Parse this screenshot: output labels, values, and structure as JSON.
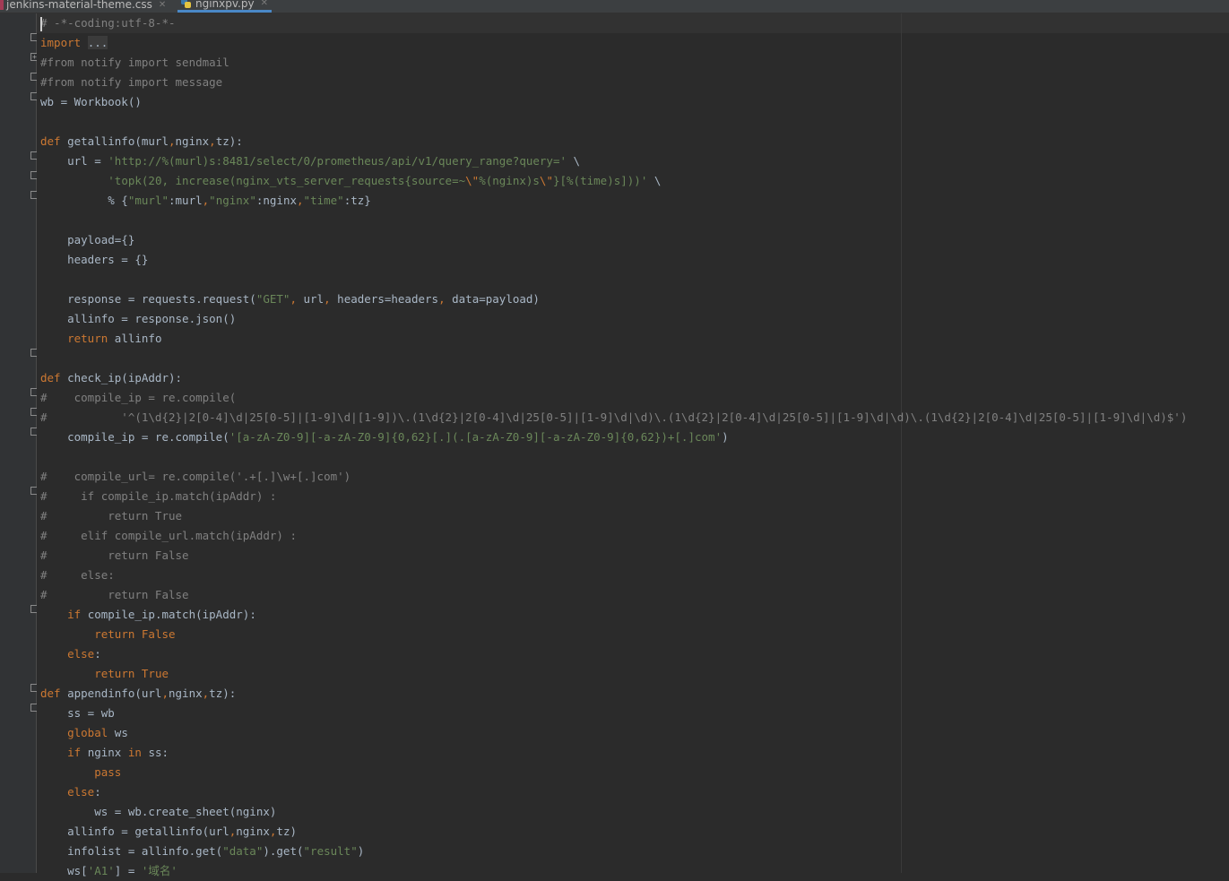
{
  "tabs": [
    {
      "label": "jenkins-material-theme.css",
      "active": false,
      "icon": "css-file-icon"
    },
    {
      "label": "nginxpv.py",
      "active": true,
      "icon": "python-file-icon"
    }
  ],
  "colors": {
    "background": "#2b2b2b",
    "gutter": "#313335",
    "keyword": "#cc7832",
    "string": "#6a8759",
    "comment": "#808080",
    "text": "#a9b7c6"
  },
  "code": [
    [
      [
        "cm",
        "# -*-coding:utf-8-*-"
      ]
    ],
    [
      [
        "kw",
        "import"
      ],
      [
        "t",
        " "
      ],
      [
        "h",
        "..."
      ]
    ],
    [
      [
        "cm",
        "#from notify import sendmail"
      ]
    ],
    [
      [
        "cm",
        "#from notify import message"
      ]
    ],
    [
      [
        "t",
        "wb = Workbook()"
      ]
    ],
    [],
    [
      [
        "kw",
        "def"
      ],
      [
        "t",
        " getallinfo(murl"
      ],
      [
        "kw",
        ","
      ],
      [
        "t",
        "nginx"
      ],
      [
        "kw",
        ","
      ],
      [
        "t",
        "tz):"
      ]
    ],
    [
      [
        "t",
        "    url = "
      ],
      [
        "s",
        "'http://%(murl)s:8481/select/0/prometheus/api/v1/query_range?query='"
      ],
      [
        "t",
        " \\"
      ]
    ],
    [
      [
        "t",
        "          "
      ],
      [
        "s",
        "'topk(20, increase(nginx_vts_server_requests{source=~"
      ],
      [
        "kw",
        "\\\""
      ],
      [
        "s",
        "%(nginx)s"
      ],
      [
        "kw",
        "\\\""
      ],
      [
        "s",
        "}[%(time)s]))'"
      ],
      [
        "t",
        " \\"
      ]
    ],
    [
      [
        "t",
        "          % {"
      ],
      [
        "s",
        "\"murl\""
      ],
      [
        "t",
        ":murl"
      ],
      [
        "kw",
        ","
      ],
      [
        "s",
        "\"nginx\""
      ],
      [
        "t",
        ":nginx"
      ],
      [
        "kw",
        ","
      ],
      [
        "s",
        "\"time\""
      ],
      [
        "t",
        ":tz}"
      ]
    ],
    [],
    [
      [
        "t",
        "    payload={}"
      ]
    ],
    [
      [
        "t",
        "    headers = {}"
      ]
    ],
    [],
    [
      [
        "t",
        "    response = requests.request("
      ],
      [
        "s",
        "\"GET\""
      ],
      [
        "kw",
        ","
      ],
      [
        "t",
        " url"
      ],
      [
        "kw",
        ","
      ],
      [
        "t",
        " headers=headers"
      ],
      [
        "kw",
        ","
      ],
      [
        "t",
        " data=payload)"
      ]
    ],
    [
      [
        "t",
        "    allinfo = response.json()"
      ]
    ],
    [
      [
        "t",
        "    "
      ],
      [
        "kw",
        "return"
      ],
      [
        "t",
        " allinfo"
      ]
    ],
    [],
    [
      [
        "kw",
        "def"
      ],
      [
        "t",
        " check_ip(ipAddr):"
      ]
    ],
    [
      [
        "cm",
        "#    compile_ip = re.compile("
      ]
    ],
    [
      [
        "cm",
        "#           '^(1\\d{2}|2[0-4]\\d|25[0-5]|[1-9]\\d|[1-9])\\.(1\\d{2}|2[0-4]\\d|25[0-5]|[1-9]\\d|\\d)\\.(1\\d{2}|2[0-4]\\d|25[0-5]|[1-9]\\d|\\d)\\.(1\\d{2}|2[0-4]\\d|25[0-5]|[1-9]\\d|\\d)$')"
      ]
    ],
    [
      [
        "t",
        "    compile_ip = re.compile("
      ],
      [
        "s",
        "'[a-zA-Z0-9][-a-zA-Z0-9]{0,62}[.](.[a-zA-Z0-9][-a-zA-Z0-9]{0,62})+[.]com'"
      ],
      [
        "t",
        ")"
      ]
    ],
    [],
    [
      [
        "cm",
        "#    compile_url= re.compile('.+[.]\\w+[.]com')"
      ]
    ],
    [
      [
        "cm",
        "#     if compile_ip.match(ipAddr) :"
      ]
    ],
    [
      [
        "cm",
        "#         return True"
      ]
    ],
    [
      [
        "cm",
        "#     elif compile_url.match(ipAddr) :"
      ]
    ],
    [
      [
        "cm",
        "#         return False"
      ]
    ],
    [
      [
        "cm",
        "#     else:"
      ]
    ],
    [
      [
        "cm",
        "#         return False"
      ]
    ],
    [
      [
        "t",
        "    "
      ],
      [
        "kw",
        "if"
      ],
      [
        "t",
        " compile_ip.match(ipAddr):"
      ]
    ],
    [
      [
        "t",
        "        "
      ],
      [
        "kw",
        "return False"
      ]
    ],
    [
      [
        "t",
        "    "
      ],
      [
        "kw",
        "else"
      ],
      [
        "t",
        ":"
      ]
    ],
    [
      [
        "t",
        "        "
      ],
      [
        "kw",
        "return True"
      ]
    ],
    [
      [
        "kw",
        "def"
      ],
      [
        "t",
        " appendinfo(url"
      ],
      [
        "kw",
        ","
      ],
      [
        "t",
        "nginx"
      ],
      [
        "kw",
        ","
      ],
      [
        "t",
        "tz):"
      ]
    ],
    [
      [
        "t",
        "    ss = wb"
      ]
    ],
    [
      [
        "t",
        "    "
      ],
      [
        "kw",
        "global"
      ],
      [
        "t",
        " ws"
      ]
    ],
    [
      [
        "t",
        "    "
      ],
      [
        "kw",
        "if"
      ],
      [
        "t",
        " nginx "
      ],
      [
        "kw",
        "in"
      ],
      [
        "t",
        " ss:"
      ]
    ],
    [
      [
        "t",
        "        "
      ],
      [
        "kw",
        "pass"
      ]
    ],
    [
      [
        "t",
        "    "
      ],
      [
        "kw",
        "else"
      ],
      [
        "t",
        ":"
      ]
    ],
    [
      [
        "t",
        "        ws = wb.create_sheet(nginx)"
      ]
    ],
    [
      [
        "t",
        "    allinfo = getallinfo(url"
      ],
      [
        "kw",
        ","
      ],
      [
        "t",
        "nginx"
      ],
      [
        "kw",
        ","
      ],
      [
        "t",
        "tz)"
      ]
    ],
    [
      [
        "t",
        "    infolist = allinfo.get("
      ],
      [
        "s",
        "\"data\""
      ],
      [
        "t",
        ").get("
      ],
      [
        "s",
        "\"result\""
      ],
      [
        "t",
        ")"
      ]
    ],
    [
      [
        "t",
        "    ws["
      ],
      [
        "s",
        "'A1'"
      ],
      [
        "t",
        "] = "
      ],
      [
        "s",
        "'域名'"
      ]
    ]
  ]
}
